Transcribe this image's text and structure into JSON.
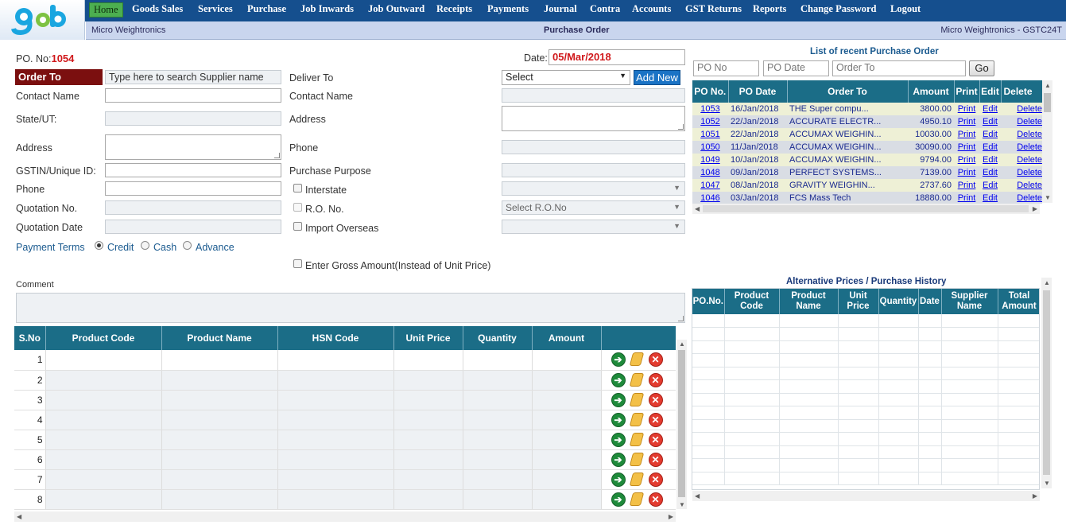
{
  "nav": {
    "items": [
      {
        "label": "Home",
        "active": true
      },
      {
        "label": "Goods Sales"
      },
      {
        "label": "Services"
      },
      {
        "label": "Purchase"
      },
      {
        "label": "Job Inwards"
      },
      {
        "label": "Job Outward"
      },
      {
        "label": "Receipts"
      },
      {
        "label": "Payments"
      },
      {
        "label": "Journal"
      },
      {
        "label": "Contra"
      },
      {
        "label": "Accounts"
      },
      {
        "label": "GST Returns"
      },
      {
        "label": "Reports"
      },
      {
        "label": "Change Password"
      },
      {
        "label": "Logout"
      }
    ]
  },
  "subbar": {
    "company_left": "Micro Weightronics",
    "page_title": "Purchase Order",
    "company_right": "Micro Weightronics - GSTC24T"
  },
  "form": {
    "po_label": "PO. No:",
    "po_value": "1054",
    "date_label": "Date:",
    "date_value": "05/Mar/2018",
    "order_to_label": "Order To",
    "supplier_placeholder": "Type here to search Supplier name",
    "contact_name_label": "Contact Name",
    "state_label": "State/UT:",
    "address_label": "Address",
    "gstin_label": "GSTIN/Unique ID:",
    "phone_label": "Phone",
    "quotation_no_label": "Quotation No.",
    "quotation_date_label": "Quotation Date",
    "payment_terms_label": "Payment Terms",
    "payment_options": [
      "Credit",
      "Cash",
      "Advance"
    ],
    "deliver_to_label": "Deliver To",
    "deliver_select": "Select",
    "add_new_label": "Add New",
    "contact_name2_label": "Contact Name",
    "address2_label": "Address",
    "phone2_label": "Phone",
    "purchase_purpose_label": "Purchase Purpose",
    "interstate_label": "Interstate",
    "ro_no_label": "R.O. No.",
    "ro_select": "Select R.O.No",
    "import_overseas_label": "Import Overseas",
    "gross_amount_label": "Enter Gross Amount(Instead of Unit Price)",
    "comment_label": "Comment"
  },
  "items_table": {
    "headers": [
      "S.No",
      "Product Code",
      "Product Name",
      "HSN Code",
      "Unit Price",
      "Quantity",
      "Amount"
    ],
    "rows": [
      "1",
      "2",
      "3",
      "4",
      "5",
      "6",
      "7",
      "8"
    ]
  },
  "recent_po": {
    "title": "List of recent Purchase Order",
    "po_no_placeholder": "PO No",
    "po_date_placeholder": "PO Date",
    "order_to_placeholder": "Order To",
    "go_label": "Go",
    "headers": [
      "PO No.",
      "PO Date",
      "Order To",
      "Amount",
      "Print",
      "Edit",
      "Delete"
    ],
    "rows": [
      {
        "po": "1053",
        "date": "16/Jan/2018",
        "to": "THE Super compu...",
        "amount": "3800.00"
      },
      {
        "po": "1052",
        "date": "22/Jan/2018",
        "to": "ACCURATE ELECTR...",
        "amount": "4950.10"
      },
      {
        "po": "1051",
        "date": "22/Jan/2018",
        "to": "ACCUMAX WEIGHIN...",
        "amount": "10030.00"
      },
      {
        "po": "1050",
        "date": "11/Jan/2018",
        "to": "ACCUMAX WEIGHIN...",
        "amount": "30090.00"
      },
      {
        "po": "1049",
        "date": "10/Jan/2018",
        "to": "ACCUMAX WEIGHIN...",
        "amount": "9794.00"
      },
      {
        "po": "1048",
        "date": "09/Jan/2018",
        "to": "PERFECT SYSTEMS...",
        "amount": "7139.00"
      },
      {
        "po": "1047",
        "date": "08/Jan/2018",
        "to": "GRAVITY WEIGHIN...",
        "amount": "2737.60"
      },
      {
        "po": "1046",
        "date": "03/Jan/2018",
        "to": "FCS Mass Tech",
        "amount": "18880.00"
      }
    ],
    "print_label": "Print",
    "edit_label": "Edit",
    "delete_label": "Delete"
  },
  "alt_prices": {
    "title": "Alternative Prices / Purchase History",
    "headers": [
      "PO.No.",
      "Product Code",
      "Product Name",
      "Unit Price",
      "Quantity",
      "Date",
      "Supplier Name",
      "Total Amount"
    ]
  },
  "colors": {
    "nav_bg": "#154f8e",
    "table_header": "#1b6d87",
    "order_to_bg": "#7b0f0f",
    "po_red": "#d0181b",
    "add_new": "#1a73c5"
  }
}
